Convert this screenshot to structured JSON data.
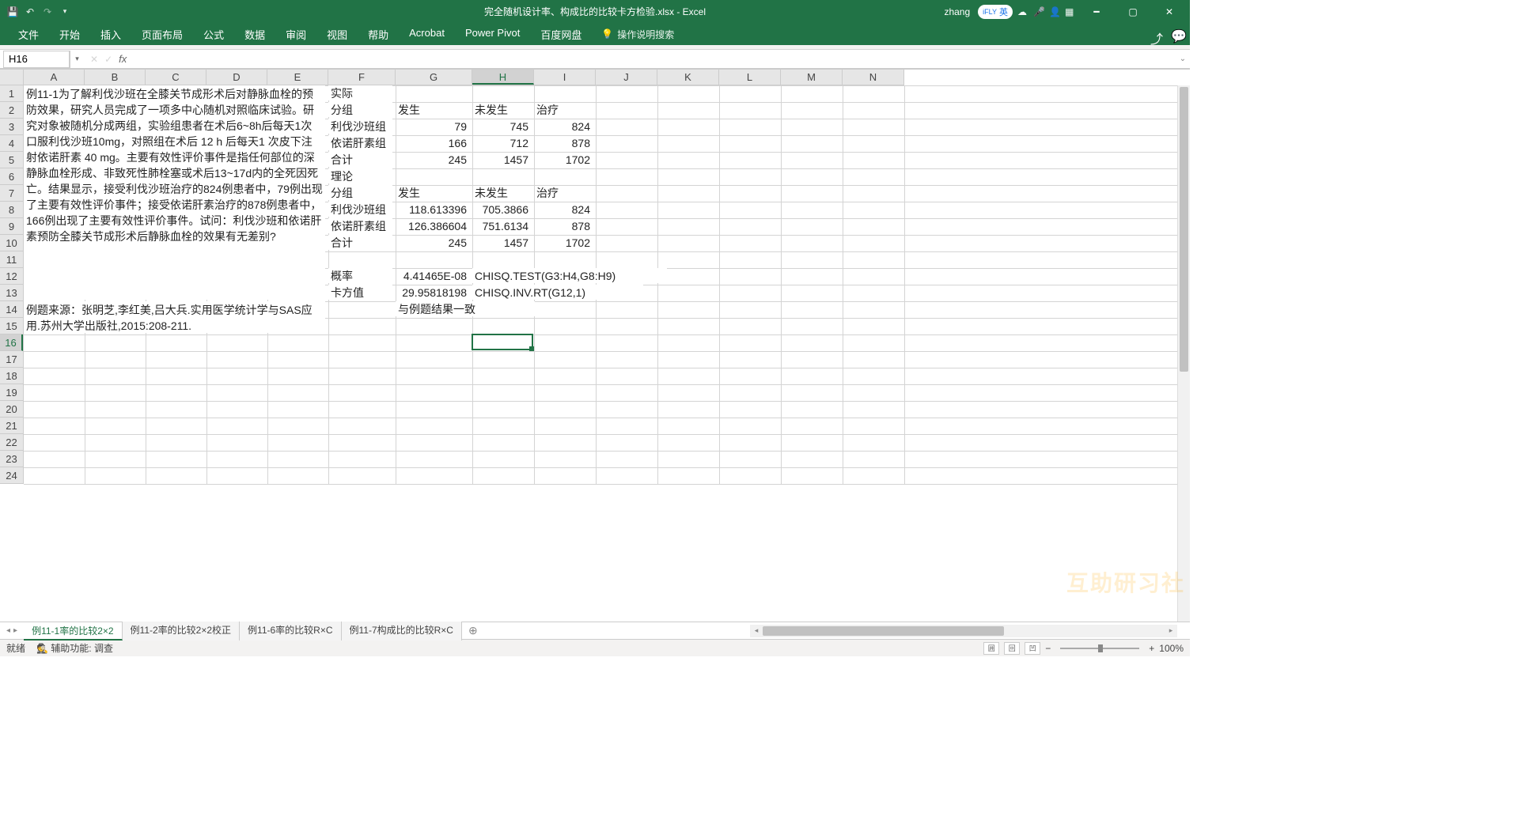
{
  "titlebar": {
    "filename": "完全随机设计率、构成比的比较卡方检验.xlsx - Excel",
    "user": "zhang",
    "ime_badge": "英"
  },
  "ribbon": {
    "tabs": [
      "文件",
      "开始",
      "插入",
      "页面布局",
      "公式",
      "数据",
      "审阅",
      "视图",
      "帮助",
      "Acrobat",
      "Power Pivot",
      "百度网盘"
    ],
    "tellme_placeholder": "操作说明搜索"
  },
  "fbar": {
    "namebox": "H16",
    "formula": ""
  },
  "cols": {
    "letters": [
      "A",
      "B",
      "C",
      "D",
      "E",
      "F",
      "G",
      "H",
      "I",
      "J",
      "K",
      "L",
      "M",
      "N"
    ],
    "widths": [
      77,
      77,
      77,
      77,
      77,
      85,
      97,
      78,
      78,
      78,
      78,
      78,
      78,
      78
    ],
    "selected": "H"
  },
  "rows": {
    "count": 24,
    "height": 21,
    "selected": 16
  },
  "merged_text_a": "例11-1为了解利伐沙班在全膝关节成形术后对静脉血栓的预防效果，研究人员完成了一项多中心随机对照临床试验。研究对象被随机分成两组，实验组患者在术后6~8h后每天1次口服利伐沙班10mg，对照组在术后 12 h 后每天1 次皮下注射依诺肝素 40 mg。主要有效性评价事件是指任何部位的深静脉血栓形成、非致死性肺栓塞或术后13~17d内的全死因死亡。结果显示，接受利伐沙班治疗的824例患者中，79例出现了主要有效性评价事件；接受依诺肝素治疗的878例患者中，166例出现了主要有效性评价事件。试问：利伐沙班和依诺肝素预防全膝关节成形术后静脉血栓的效果有无差别?",
  "merged_text_b": "例题来源：张明芝,李红美,吕大兵.实用医学统计学与SAS应用.苏州大学出版社,2015:208-211.",
  "cells": {
    "F1": "实际",
    "F2": "分组",
    "G2": "发生",
    "H2": "未发生",
    "I2": "治疗",
    "F3": "利伐沙班组",
    "G3": "79",
    "H3": "745",
    "I3": "824",
    "F4": "依诺肝素组",
    "G4": "166",
    "H4": "712",
    "I4": "878",
    "F5": "合计",
    "G5": "245",
    "H5": "1457",
    "I5": "1702",
    "F6": "理论",
    "F7": "分组",
    "G7": "发生",
    "H7": "未发生",
    "I7": "治疗",
    "F8": "利伐沙班组",
    "G8": "118.613396",
    "H8": "705.3866",
    "I8": "824",
    "F9": "依诺肝素组",
    "G9": "126.386604",
    "H9": "751.6134",
    "I9": "878",
    "F10": "合计",
    "G10": "245",
    "H10": "1457",
    "I10": "1702",
    "F12": "概率",
    "G12": "4.41465E-08",
    "H12": "CHISQ.TEST(G3:H4,G8:H9)",
    "F13": "卡方值",
    "G13": "29.95818198",
    "H13": "CHISQ.INV.RT(G12,1)",
    "G14": "与例题结果一致"
  },
  "sheet_tabs": {
    "active": 0,
    "tabs": [
      "例11-1率的比较2×2",
      "例11-2率的比较2×2校正",
      "例11-6率的比较R×C",
      "例11-7构成比的比较R×C"
    ]
  },
  "status": {
    "ready": "就绪",
    "accessibility": "辅助功能: 调查",
    "view_icons": [
      "囲",
      "回",
      "凹"
    ],
    "zoom": "100%"
  }
}
